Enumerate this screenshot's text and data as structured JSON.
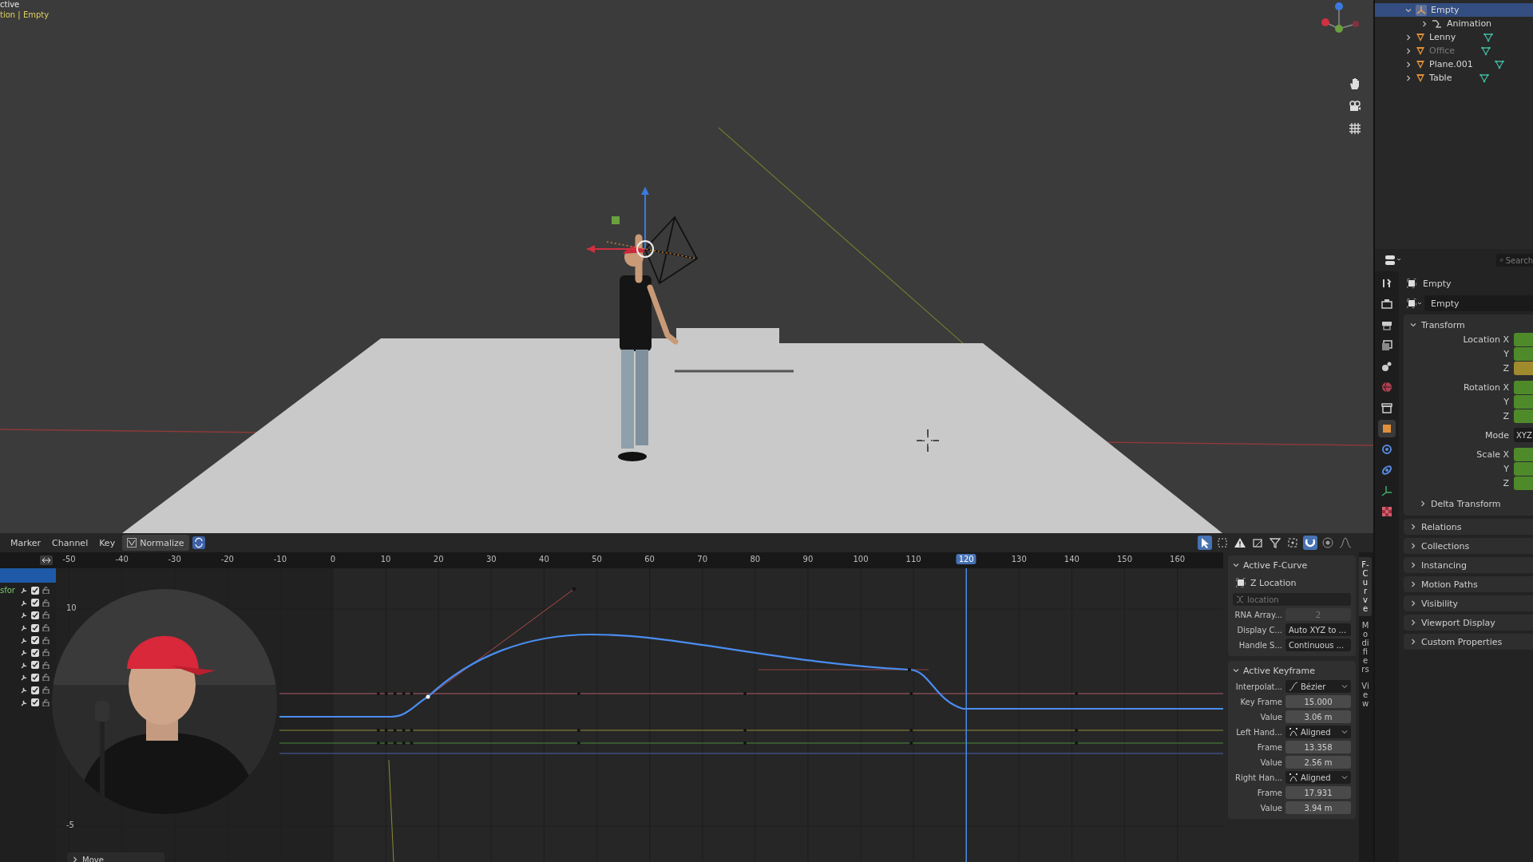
{
  "viewport": {
    "overlay_lines": [
      "ctive",
      "tion | Empty"
    ]
  },
  "outliner": {
    "items": [
      {
        "label": "Empty",
        "kind": "empty",
        "selected": true,
        "expanded": true,
        "disabled": false,
        "children": [
          {
            "label": "Animation",
            "kind": "action",
            "selected": false,
            "expanded": false,
            "disabled": false
          }
        ]
      },
      {
        "label": "Lenny",
        "kind": "mesh",
        "selected": false,
        "expanded": false,
        "disabled": false
      },
      {
        "label": "Office",
        "kind": "mesh",
        "selected": false,
        "expanded": false,
        "disabled": true
      },
      {
        "label": "Plane.001",
        "kind": "mesh",
        "selected": false,
        "expanded": false,
        "disabled": false
      },
      {
        "label": "Table",
        "kind": "mesh",
        "selected": false,
        "expanded": false,
        "disabled": false
      }
    ]
  },
  "properties": {
    "search": {
      "placeholder": "Search"
    },
    "tabs": [
      {
        "kind": "tool",
        "selected": false
      },
      {
        "kind": "render",
        "selected": false
      },
      {
        "kind": "output",
        "selected": false
      },
      {
        "kind": "view_layer",
        "selected": false
      },
      {
        "kind": "scene",
        "selected": false
      },
      {
        "kind": "world",
        "selected": false
      },
      {
        "kind": "collection",
        "selected": false
      },
      {
        "kind": "object",
        "selected": true
      },
      {
        "kind": "physics",
        "selected": false
      },
      {
        "kind": "constraint",
        "selected": false
      },
      {
        "kind": "data",
        "selected": false
      },
      {
        "kind": "texture",
        "selected": false
      }
    ],
    "object_name": "Empty",
    "datablock": "Empty",
    "transform": {
      "title": "Transform",
      "expanded": true,
      "rows": [
        {
          "label": "Location X",
          "kind": "field",
          "color": "#4e8a2a"
        },
        {
          "label": "Y",
          "kind": "field",
          "color": "#4e8a2a"
        },
        {
          "label": "Z",
          "kind": "field",
          "color": "#a08a2e"
        },
        {
          "label": "Rotation X",
          "kind": "field",
          "color": "#4e8a2a"
        },
        {
          "label": "Y",
          "kind": "field",
          "color": "#4e8a2a"
        },
        {
          "label": "Z",
          "kind": "field",
          "color": "#4e8a2a"
        },
        {
          "label": "Mode",
          "kind": "select",
          "value": "XYZ"
        },
        {
          "label": "Scale X",
          "kind": "field",
          "color": "#4e8a2a"
        },
        {
          "label": "Y",
          "kind": "field",
          "color": "#4e8a2a"
        },
        {
          "label": "Z",
          "kind": "field",
          "color": "#4e8a2a"
        }
      ],
      "subpanels": [
        {
          "title": "Delta Transform",
          "expanded": false
        }
      ]
    },
    "panels": [
      {
        "title": "Relations",
        "expanded": false
      },
      {
        "title": "Collections",
        "expanded": false
      },
      {
        "title": "Instancing",
        "expanded": false
      },
      {
        "title": "Motion Paths",
        "expanded": false
      },
      {
        "title": "Visibility",
        "expanded": false
      },
      {
        "title": "Viewport Display",
        "expanded": false
      },
      {
        "title": "Custom Properties",
        "expanded": false
      }
    ]
  },
  "graph_editor": {
    "menus": [
      "Marker",
      "Channel",
      "Key"
    ],
    "normalize": {
      "label": "Normalize",
      "on": false
    },
    "tools": [
      {
        "kind": "select",
        "on": true
      },
      {
        "kind": "box",
        "on": false
      },
      {
        "kind": "warning",
        "on": false
      },
      {
        "kind": "crop",
        "on": false
      },
      {
        "kind": "filter",
        "on": false
      },
      {
        "kind": "pivot",
        "on": false
      },
      {
        "kind": "snap",
        "on": true
      },
      {
        "kind": "proportional",
        "on": false
      },
      {
        "kind": "falloff",
        "on": false
      }
    ],
    "ruler": {
      "ticks": [
        "-50",
        "-40",
        "-30",
        "-20",
        "-10",
        "0",
        "10",
        "20",
        "30",
        "40",
        "50",
        "60",
        "70",
        "80",
        "90",
        "100",
        "110",
        "130",
        "140",
        "150",
        "160"
      ],
      "current_frame": "120"
    },
    "y_labels": [
      "10",
      "-5"
    ],
    "channels": [
      {
        "label": "sfor",
        "checked": true
      },
      {
        "checked": true
      },
      {
        "checked": true
      },
      {
        "checked": true
      },
      {
        "checked": true
      },
      {
        "checked": true
      },
      {
        "checked": true
      },
      {
        "checked": true
      },
      {
        "checked": true
      },
      {
        "checked": true
      }
    ],
    "last_operator": "Move",
    "sidebar": {
      "tabs": [
        {
          "label": "F-Curve",
          "selected": true
        },
        {
          "label": "Modifiers",
          "selected": false
        },
        {
          "label": "View",
          "selected": false
        }
      ],
      "active_fcurve": {
        "title": "Active F-Curve",
        "expanded": true,
        "channel": "Z Location",
        "data_path": "location",
        "rows": [
          {
            "label": "RNA Array...",
            "value": "2",
            "kind": "disabled"
          },
          {
            "label": "Display C...",
            "value": "Auto XYZ to ...",
            "kind": "select"
          },
          {
            "label": "Handle S...",
            "value": "Continuous ...",
            "kind": "select"
          }
        ]
      },
      "active_keyframe": {
        "title": "Active Keyframe",
        "expanded": true,
        "rows": [
          {
            "label": "Interpolat...",
            "value": "Bézier",
            "kind": "select_bezier"
          },
          {
            "label": "Key Frame",
            "value": "15.000",
            "kind": "number"
          },
          {
            "label": "Value",
            "value": "3.06 m",
            "kind": "number"
          },
          {
            "label": "Left Hand...",
            "value": "Aligned",
            "kind": "select_handle"
          },
          {
            "label": "Frame",
            "value": "13.358",
            "kind": "number"
          },
          {
            "label": "Value",
            "value": "2.56 m",
            "kind": "number"
          },
          {
            "label": "Right Han...",
            "value": "Aligned",
            "kind": "select_handle"
          },
          {
            "label": "Frame",
            "value": "17.931",
            "kind": "number"
          },
          {
            "label": "Value",
            "value": "3.94 m",
            "kind": "number"
          }
        ]
      }
    }
  }
}
